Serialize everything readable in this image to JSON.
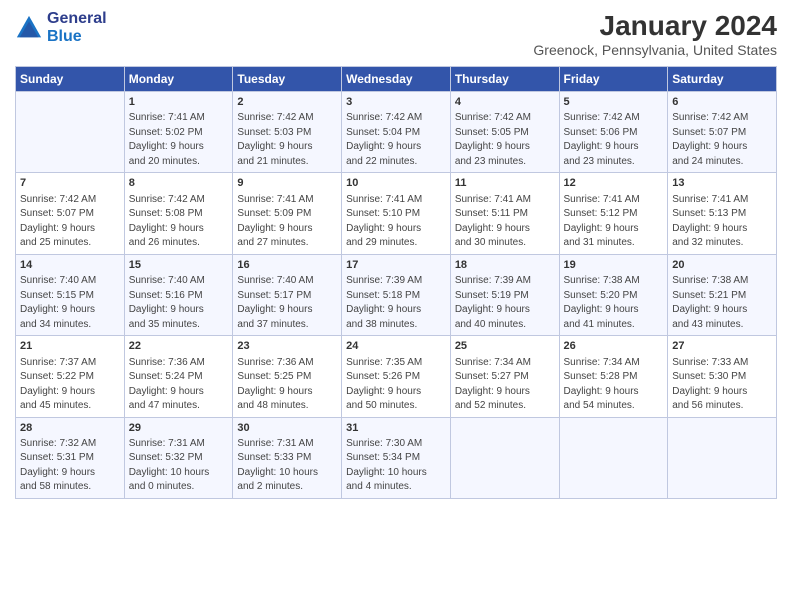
{
  "header": {
    "logo_line1": "General",
    "logo_line2": "Blue",
    "title": "January 2024",
    "subtitle": "Greenock, Pennsylvania, United States"
  },
  "days_of_week": [
    "Sunday",
    "Monday",
    "Tuesday",
    "Wednesday",
    "Thursday",
    "Friday",
    "Saturday"
  ],
  "weeks": [
    [
      {
        "day": "",
        "content": ""
      },
      {
        "day": "1",
        "content": "Sunrise: 7:41 AM\nSunset: 5:02 PM\nDaylight: 9 hours\nand 20 minutes."
      },
      {
        "day": "2",
        "content": "Sunrise: 7:42 AM\nSunset: 5:03 PM\nDaylight: 9 hours\nand 21 minutes."
      },
      {
        "day": "3",
        "content": "Sunrise: 7:42 AM\nSunset: 5:04 PM\nDaylight: 9 hours\nand 22 minutes."
      },
      {
        "day": "4",
        "content": "Sunrise: 7:42 AM\nSunset: 5:05 PM\nDaylight: 9 hours\nand 23 minutes."
      },
      {
        "day": "5",
        "content": "Sunrise: 7:42 AM\nSunset: 5:06 PM\nDaylight: 9 hours\nand 23 minutes."
      },
      {
        "day": "6",
        "content": "Sunrise: 7:42 AM\nSunset: 5:07 PM\nDaylight: 9 hours\nand 24 minutes."
      }
    ],
    [
      {
        "day": "7",
        "content": "Sunrise: 7:42 AM\nSunset: 5:07 PM\nDaylight: 9 hours\nand 25 minutes."
      },
      {
        "day": "8",
        "content": "Sunrise: 7:42 AM\nSunset: 5:08 PM\nDaylight: 9 hours\nand 26 minutes."
      },
      {
        "day": "9",
        "content": "Sunrise: 7:41 AM\nSunset: 5:09 PM\nDaylight: 9 hours\nand 27 minutes."
      },
      {
        "day": "10",
        "content": "Sunrise: 7:41 AM\nSunset: 5:10 PM\nDaylight: 9 hours\nand 29 minutes."
      },
      {
        "day": "11",
        "content": "Sunrise: 7:41 AM\nSunset: 5:11 PM\nDaylight: 9 hours\nand 30 minutes."
      },
      {
        "day": "12",
        "content": "Sunrise: 7:41 AM\nSunset: 5:12 PM\nDaylight: 9 hours\nand 31 minutes."
      },
      {
        "day": "13",
        "content": "Sunrise: 7:41 AM\nSunset: 5:13 PM\nDaylight: 9 hours\nand 32 minutes."
      }
    ],
    [
      {
        "day": "14",
        "content": "Sunrise: 7:40 AM\nSunset: 5:15 PM\nDaylight: 9 hours\nand 34 minutes."
      },
      {
        "day": "15",
        "content": "Sunrise: 7:40 AM\nSunset: 5:16 PM\nDaylight: 9 hours\nand 35 minutes."
      },
      {
        "day": "16",
        "content": "Sunrise: 7:40 AM\nSunset: 5:17 PM\nDaylight: 9 hours\nand 37 minutes."
      },
      {
        "day": "17",
        "content": "Sunrise: 7:39 AM\nSunset: 5:18 PM\nDaylight: 9 hours\nand 38 minutes."
      },
      {
        "day": "18",
        "content": "Sunrise: 7:39 AM\nSunset: 5:19 PM\nDaylight: 9 hours\nand 40 minutes."
      },
      {
        "day": "19",
        "content": "Sunrise: 7:38 AM\nSunset: 5:20 PM\nDaylight: 9 hours\nand 41 minutes."
      },
      {
        "day": "20",
        "content": "Sunrise: 7:38 AM\nSunset: 5:21 PM\nDaylight: 9 hours\nand 43 minutes."
      }
    ],
    [
      {
        "day": "21",
        "content": "Sunrise: 7:37 AM\nSunset: 5:22 PM\nDaylight: 9 hours\nand 45 minutes."
      },
      {
        "day": "22",
        "content": "Sunrise: 7:36 AM\nSunset: 5:24 PM\nDaylight: 9 hours\nand 47 minutes."
      },
      {
        "day": "23",
        "content": "Sunrise: 7:36 AM\nSunset: 5:25 PM\nDaylight: 9 hours\nand 48 minutes."
      },
      {
        "day": "24",
        "content": "Sunrise: 7:35 AM\nSunset: 5:26 PM\nDaylight: 9 hours\nand 50 minutes."
      },
      {
        "day": "25",
        "content": "Sunrise: 7:34 AM\nSunset: 5:27 PM\nDaylight: 9 hours\nand 52 minutes."
      },
      {
        "day": "26",
        "content": "Sunrise: 7:34 AM\nSunset: 5:28 PM\nDaylight: 9 hours\nand 54 minutes."
      },
      {
        "day": "27",
        "content": "Sunrise: 7:33 AM\nSunset: 5:30 PM\nDaylight: 9 hours\nand 56 minutes."
      }
    ],
    [
      {
        "day": "28",
        "content": "Sunrise: 7:32 AM\nSunset: 5:31 PM\nDaylight: 9 hours\nand 58 minutes."
      },
      {
        "day": "29",
        "content": "Sunrise: 7:31 AM\nSunset: 5:32 PM\nDaylight: 10 hours\nand 0 minutes."
      },
      {
        "day": "30",
        "content": "Sunrise: 7:31 AM\nSunset: 5:33 PM\nDaylight: 10 hours\nand 2 minutes."
      },
      {
        "day": "31",
        "content": "Sunrise: 7:30 AM\nSunset: 5:34 PM\nDaylight: 10 hours\nand 4 minutes."
      },
      {
        "day": "",
        "content": ""
      },
      {
        "day": "",
        "content": ""
      },
      {
        "day": "",
        "content": ""
      }
    ]
  ]
}
